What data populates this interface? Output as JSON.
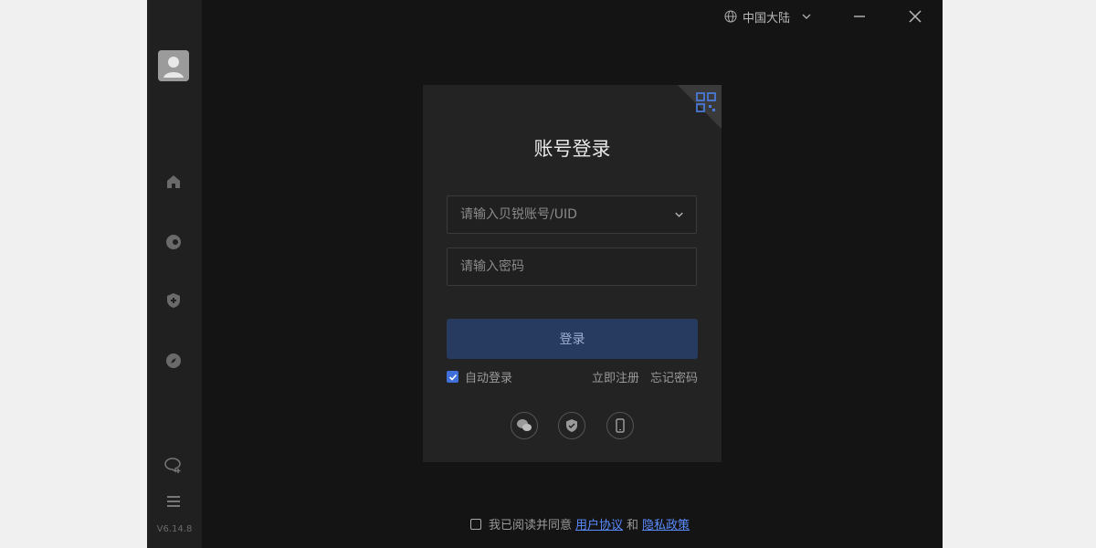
{
  "window": {
    "region_label": "中国大陆",
    "minimize_label": "minimize",
    "close_label": "close"
  },
  "sidebar": {
    "version": "V6.14.8",
    "icons": [
      "user-avatar",
      "home-icon",
      "remote-icon",
      "shield-plus-icon",
      "compass-icon",
      "chat-add-icon",
      "menu-icon"
    ]
  },
  "login": {
    "title": "账号登录",
    "account_placeholder": "请输入贝锐账号/UID",
    "password_placeholder": "请输入密码",
    "login_button": "登录",
    "auto_login_label": "自动登录",
    "auto_login_checked": true,
    "register_link": "立即注册",
    "forgot_link": "忘记密码",
    "social_icons": [
      "wechat-icon",
      "shield-check-icon",
      "phone-icon"
    ]
  },
  "agreement": {
    "text_prefix": "我已阅读并同意",
    "user_agreement": "用户协议",
    "and": "和",
    "privacy_policy": "隐私政策"
  },
  "colors": {
    "accent_blue": "#3f6fd8",
    "link_blue": "#5a8cff",
    "button_bg": "#273a5f"
  }
}
